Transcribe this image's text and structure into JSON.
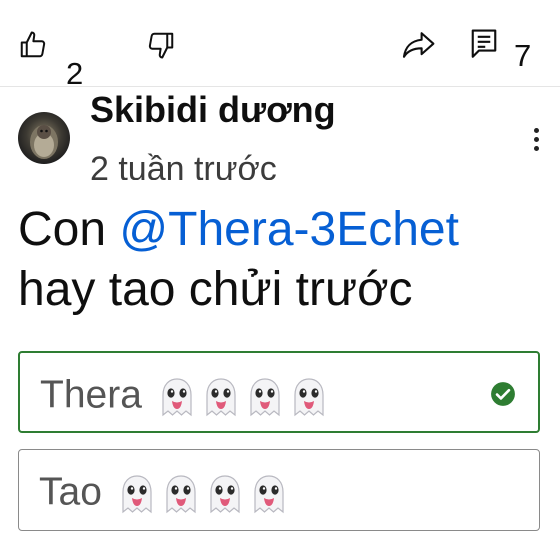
{
  "actions": {
    "like_count": "2",
    "comment_count": "7"
  },
  "comment": {
    "author": "Skibidi dương",
    "timestamp": "2 tuần trước",
    "text_prefix": "Con ",
    "mention": "@Thera-3Echet",
    "text_suffix": "hay tao chửi trước"
  },
  "poll": {
    "options": [
      {
        "label": "Thera",
        "ghost_count": 4,
        "selected": true
      },
      {
        "label": "Tao",
        "ghost_count": 4,
        "selected": false
      }
    ]
  },
  "colors": {
    "mention": "#065fd4",
    "selected_border": "#2e7d32",
    "check": "#2e7d32"
  },
  "icons": [
    "thumbs-up-icon",
    "thumbs-down-icon",
    "share-icon",
    "comment-icon",
    "more-vert-icon",
    "check-circle-icon",
    "ghost-emoji-icon"
  ]
}
